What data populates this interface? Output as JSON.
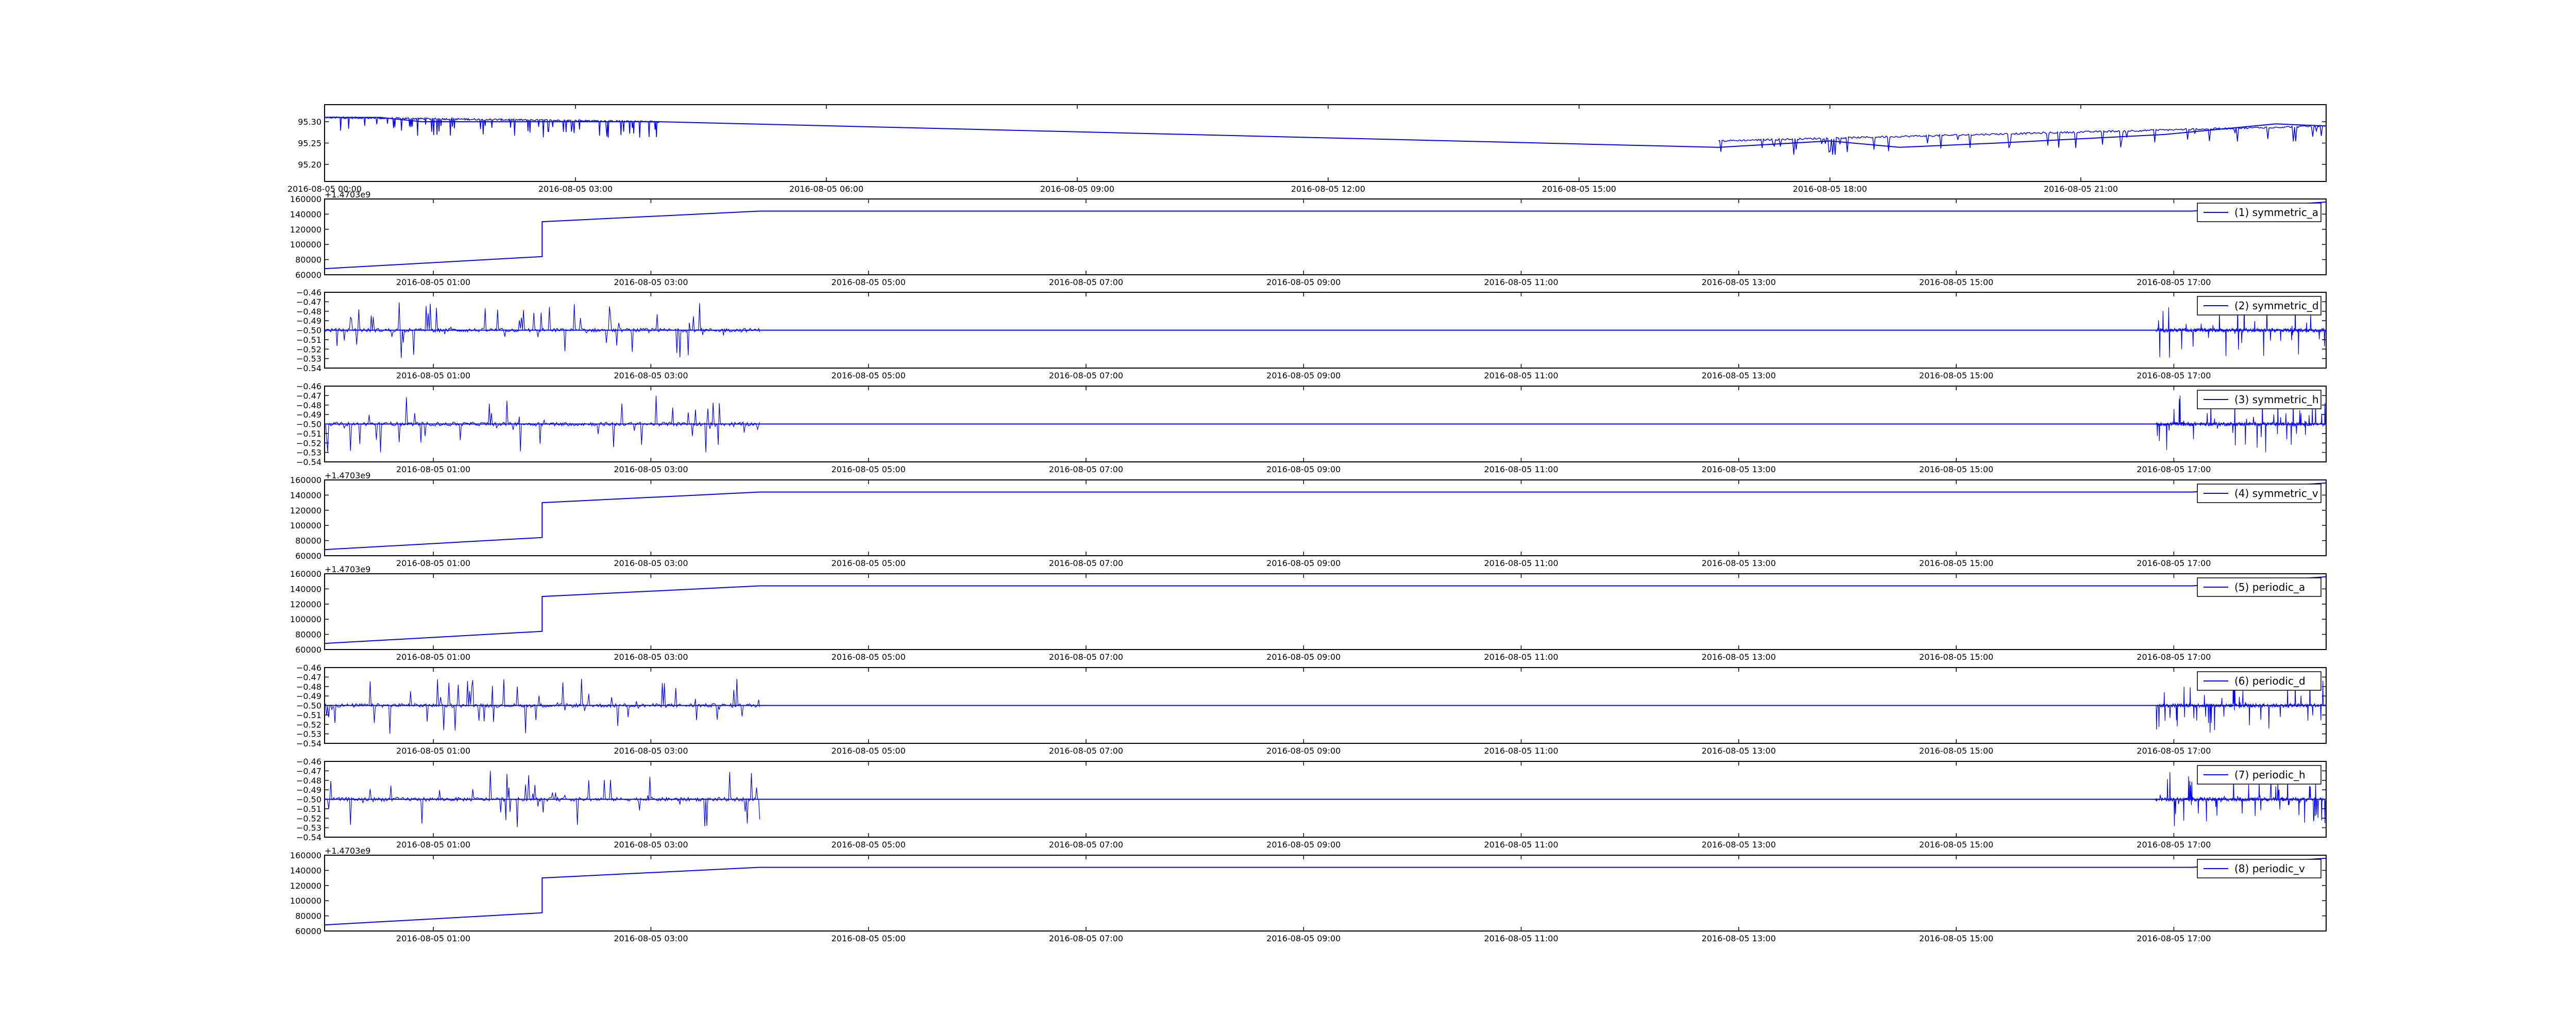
{
  "chart_data": [
    {
      "type": "line",
      "x_format": "datetime",
      "color": "#0000ff",
      "ylim": [
        95.16,
        95.34
      ],
      "y_ticks": [
        95.2,
        95.25,
        95.3
      ],
      "y_tick_labels": [
        "95.20",
        "95.25",
        "95.30"
      ],
      "x_ticks": [
        "2016-08-05 00:00",
        "2016-08-05 03:00",
        "2016-08-05 06:00",
        "2016-08-05 09:00",
        "2016-08-05 12:00",
        "2016-08-05 15:00",
        "2016-08-05 18:00",
        "2016-08-05 21:00"
      ],
      "x_tick_labels": [
        "2016-08-05 00:00",
        "2016-08-05 03:00",
        "2016-08-05 06:00",
        "2016-08-05 09:00",
        "2016-08-05 12:00",
        "2016-08-05 15:00",
        "2016-08-05 18:00",
        "2016-08-05 21:00"
      ],
      "xlim": [
        "2016-08-05 00:00",
        "2016-08-05 23:56"
      ],
      "series": [
        {
          "x": [
            "2016-08-05 00:00",
            "2016-08-05 00:40",
            "2016-08-05 01:10",
            "2016-08-05 02:00",
            "2016-08-05 03:00",
            "2016-08-05 04:00",
            "2016-08-05 16:40",
            "2016-08-05 18:00",
            "2016-08-05 18:50",
            "2016-08-05 20:00",
            "2016-08-05 22:00",
            "2016-08-05 23:20",
            "2016-08-05 23:56"
          ],
          "values": [
            95.31,
            95.31,
            95.3,
            95.3,
            95.3,
            95.3,
            95.24,
            95.255,
            95.24,
            95.25,
            95.27,
            95.295,
            95.29
          ]
        }
      ]
    },
    {
      "type": "line",
      "x_format": "datetime",
      "color": "#0000ff",
      "y_offset_label": "+1.4703e9",
      "ylim": [
        60000,
        160000
      ],
      "y_ticks": [
        60000,
        80000,
        100000,
        120000,
        140000,
        160000
      ],
      "y_tick_labels": [
        "60000",
        "80000",
        "100000",
        "120000",
        "140000",
        "160000"
      ],
      "x_ticks": [
        "2016-08-05 01:00",
        "2016-08-05 03:00",
        "2016-08-05 05:00",
        "2016-08-05 07:00",
        "2016-08-05 09:00",
        "2016-08-05 11:00",
        "2016-08-05 13:00",
        "2016-08-05 15:00",
        "2016-08-05 17:00"
      ],
      "x_tick_labels": [
        "2016-08-05 01:00",
        "2016-08-05 03:00",
        "2016-08-05 05:00",
        "2016-08-05 07:00",
        "2016-08-05 09:00",
        "2016-08-05 11:00",
        "2016-08-05 13:00",
        "2016-08-05 15:00",
        "2016-08-05 17:00"
      ],
      "xlim": [
        "2016-08-05 00:00",
        "2016-08-05 18:24"
      ],
      "legend_location": "upper right",
      "series": [
        {
          "name": "(1) symmetric_a",
          "x": [
            "2016-08-05 00:00",
            "2016-08-05 02:00",
            "2016-08-05 02:00",
            "2016-08-05 04:00",
            "2016-08-05 16:50",
            "2016-08-05 17:10",
            "2016-08-05 18:24"
          ],
          "values": [
            68000,
            84000,
            130000,
            144000,
            144000,
            144000,
            156000
          ]
        }
      ]
    },
    {
      "type": "line",
      "x_format": "datetime",
      "color": "#0000ff",
      "ylim": [
        -0.54,
        -0.46
      ],
      "y_ticks": [
        -0.54,
        -0.53,
        -0.52,
        -0.51,
        -0.5,
        -0.49,
        -0.48,
        -0.47,
        -0.46
      ],
      "y_tick_labels": [
        "−0.54",
        "−0.53",
        "−0.52",
        "−0.51",
        "−0.50",
        "−0.49",
        "−0.48",
        "−0.47",
        "−0.46"
      ],
      "x_ticks": [
        "2016-08-05 01:00",
        "2016-08-05 03:00",
        "2016-08-05 05:00",
        "2016-08-05 07:00",
        "2016-08-05 09:00",
        "2016-08-05 11:00",
        "2016-08-05 13:00",
        "2016-08-05 15:00",
        "2016-08-05 17:00"
      ],
      "x_tick_labels": [
        "2016-08-05 01:00",
        "2016-08-05 03:00",
        "2016-08-05 05:00",
        "2016-08-05 07:00",
        "2016-08-05 09:00",
        "2016-08-05 11:00",
        "2016-08-05 13:00",
        "2016-08-05 15:00",
        "2016-08-05 17:00"
      ],
      "xlim": [
        "2016-08-05 00:00",
        "2016-08-05 18:24"
      ],
      "legend_location": "upper right",
      "series": [
        {
          "name": "(2) symmetric_d",
          "x": [
            "2016-08-05 00:00",
            "2016-08-05 04:00",
            "2016-08-05 16:50",
            "2016-08-05 18:24"
          ],
          "values": [
            -0.5,
            -0.5,
            -0.5,
            -0.5
          ],
          "noise_range": [
            -0.53,
            -0.47
          ]
        }
      ]
    },
    {
      "type": "line",
      "x_format": "datetime",
      "color": "#0000ff",
      "ylim": [
        -0.54,
        -0.46
      ],
      "y_ticks": [
        -0.54,
        -0.53,
        -0.52,
        -0.51,
        -0.5,
        -0.49,
        -0.48,
        -0.47,
        -0.46
      ],
      "y_tick_labels": [
        "−0.54",
        "−0.53",
        "−0.52",
        "−0.51",
        "−0.50",
        "−0.49",
        "−0.48",
        "−0.47",
        "−0.46"
      ],
      "x_ticks": [
        "2016-08-05 01:00",
        "2016-08-05 03:00",
        "2016-08-05 05:00",
        "2016-08-05 07:00",
        "2016-08-05 09:00",
        "2016-08-05 11:00",
        "2016-08-05 13:00",
        "2016-08-05 15:00",
        "2016-08-05 17:00"
      ],
      "x_tick_labels": [
        "2016-08-05 01:00",
        "2016-08-05 03:00",
        "2016-08-05 05:00",
        "2016-08-05 07:00",
        "2016-08-05 09:00",
        "2016-08-05 11:00",
        "2016-08-05 13:00",
        "2016-08-05 15:00",
        "2016-08-05 17:00"
      ],
      "xlim": [
        "2016-08-05 00:00",
        "2016-08-05 18:24"
      ],
      "legend_location": "upper right",
      "series": [
        {
          "name": "(3) symmetric_h",
          "x": [
            "2016-08-05 00:00",
            "2016-08-05 04:00",
            "2016-08-05 16:50",
            "2016-08-05 18:24"
          ],
          "values": [
            -0.5,
            -0.5,
            -0.5,
            -0.5
          ],
          "noise_range": [
            -0.53,
            -0.47
          ]
        }
      ]
    },
    {
      "type": "line",
      "x_format": "datetime",
      "color": "#0000ff",
      "y_offset_label": "+1.4703e9",
      "ylim": [
        60000,
        160000
      ],
      "y_ticks": [
        60000,
        80000,
        100000,
        120000,
        140000,
        160000
      ],
      "y_tick_labels": [
        "60000",
        "80000",
        "100000",
        "120000",
        "140000",
        "160000"
      ],
      "x_ticks": [
        "2016-08-05 01:00",
        "2016-08-05 03:00",
        "2016-08-05 05:00",
        "2016-08-05 07:00",
        "2016-08-05 09:00",
        "2016-08-05 11:00",
        "2016-08-05 13:00",
        "2016-08-05 15:00",
        "2016-08-05 17:00"
      ],
      "x_tick_labels": [
        "2016-08-05 01:00",
        "2016-08-05 03:00",
        "2016-08-05 05:00",
        "2016-08-05 07:00",
        "2016-08-05 09:00",
        "2016-08-05 11:00",
        "2016-08-05 13:00",
        "2016-08-05 15:00",
        "2016-08-05 17:00"
      ],
      "xlim": [
        "2016-08-05 00:00",
        "2016-08-05 18:24"
      ],
      "legend_location": "upper right",
      "series": [
        {
          "name": "(4) symmetric_v",
          "x": [
            "2016-08-05 00:00",
            "2016-08-05 02:00",
            "2016-08-05 02:00",
            "2016-08-05 04:00",
            "2016-08-05 16:50",
            "2016-08-05 17:10",
            "2016-08-05 18:24"
          ],
          "values": [
            68000,
            84000,
            130000,
            144000,
            144000,
            144000,
            156000
          ]
        }
      ]
    },
    {
      "type": "line",
      "x_format": "datetime",
      "color": "#0000ff",
      "y_offset_label": "+1.4703e9",
      "ylim": [
        60000,
        160000
      ],
      "y_ticks": [
        60000,
        80000,
        100000,
        120000,
        140000,
        160000
      ],
      "y_tick_labels": [
        "60000",
        "80000",
        "100000",
        "120000",
        "140000",
        "160000"
      ],
      "x_ticks": [
        "2016-08-05 01:00",
        "2016-08-05 03:00",
        "2016-08-05 05:00",
        "2016-08-05 07:00",
        "2016-08-05 09:00",
        "2016-08-05 11:00",
        "2016-08-05 13:00",
        "2016-08-05 15:00",
        "2016-08-05 17:00"
      ],
      "x_tick_labels": [
        "2016-08-05 01:00",
        "2016-08-05 03:00",
        "2016-08-05 05:00",
        "2016-08-05 07:00",
        "2016-08-05 09:00",
        "2016-08-05 11:00",
        "2016-08-05 13:00",
        "2016-08-05 15:00",
        "2016-08-05 17:00"
      ],
      "xlim": [
        "2016-08-05 00:00",
        "2016-08-05 18:24"
      ],
      "legend_location": "upper right",
      "series": [
        {
          "name": "(5) periodic_a",
          "x": [
            "2016-08-05 00:00",
            "2016-08-05 02:00",
            "2016-08-05 02:00",
            "2016-08-05 04:00",
            "2016-08-05 16:50",
            "2016-08-05 17:10",
            "2016-08-05 18:24"
          ],
          "values": [
            68000,
            84000,
            130000,
            144000,
            144000,
            144000,
            156000
          ]
        }
      ]
    },
    {
      "type": "line",
      "x_format": "datetime",
      "color": "#0000ff",
      "ylim": [
        -0.54,
        -0.46
      ],
      "y_ticks": [
        -0.54,
        -0.53,
        -0.52,
        -0.51,
        -0.5,
        -0.49,
        -0.48,
        -0.47,
        -0.46
      ],
      "y_tick_labels": [
        "−0.54",
        "−0.53",
        "−0.52",
        "−0.51",
        "−0.50",
        "−0.49",
        "−0.48",
        "−0.47",
        "−0.46"
      ],
      "x_ticks": [
        "2016-08-05 01:00",
        "2016-08-05 03:00",
        "2016-08-05 05:00",
        "2016-08-05 07:00",
        "2016-08-05 09:00",
        "2016-08-05 11:00",
        "2016-08-05 13:00",
        "2016-08-05 15:00",
        "2016-08-05 17:00"
      ],
      "x_tick_labels": [
        "2016-08-05 01:00",
        "2016-08-05 03:00",
        "2016-08-05 05:00",
        "2016-08-05 07:00",
        "2016-08-05 09:00",
        "2016-08-05 11:00",
        "2016-08-05 13:00",
        "2016-08-05 15:00",
        "2016-08-05 17:00"
      ],
      "xlim": [
        "2016-08-05 00:00",
        "2016-08-05 18:24"
      ],
      "legend_location": "upper right",
      "series": [
        {
          "name": "(6) periodic_d",
          "x": [
            "2016-08-05 00:00",
            "2016-08-05 04:00",
            "2016-08-05 16:50",
            "2016-08-05 18:24"
          ],
          "values": [
            -0.5,
            -0.5,
            -0.5,
            -0.5
          ],
          "noise_range": [
            -0.53,
            -0.47
          ]
        }
      ]
    },
    {
      "type": "line",
      "x_format": "datetime",
      "color": "#0000ff",
      "ylim": [
        -0.54,
        -0.46
      ],
      "y_ticks": [
        -0.54,
        -0.53,
        -0.52,
        -0.51,
        -0.5,
        -0.49,
        -0.48,
        -0.47,
        -0.46
      ],
      "y_tick_labels": [
        "−0.54",
        "−0.53",
        "−0.52",
        "−0.51",
        "−0.50",
        "−0.49",
        "−0.48",
        "−0.47",
        "−0.46"
      ],
      "x_ticks": [
        "2016-08-05 01:00",
        "2016-08-05 03:00",
        "2016-08-05 05:00",
        "2016-08-05 07:00",
        "2016-08-05 09:00",
        "2016-08-05 11:00",
        "2016-08-05 13:00",
        "2016-08-05 15:00",
        "2016-08-05 17:00"
      ],
      "x_tick_labels": [
        "2016-08-05 01:00",
        "2016-08-05 03:00",
        "2016-08-05 05:00",
        "2016-08-05 07:00",
        "2016-08-05 09:00",
        "2016-08-05 11:00",
        "2016-08-05 13:00",
        "2016-08-05 15:00",
        "2016-08-05 17:00"
      ],
      "xlim": [
        "2016-08-05 00:00",
        "2016-08-05 18:24"
      ],
      "legend_location": "upper right",
      "series": [
        {
          "name": "(7) periodic_h",
          "x": [
            "2016-08-05 00:00",
            "2016-08-05 04:00",
            "2016-08-05 16:50",
            "2016-08-05 18:24"
          ],
          "values": [
            -0.5,
            -0.5,
            -0.5,
            -0.5
          ],
          "noise_range": [
            -0.53,
            -0.47
          ]
        }
      ]
    },
    {
      "type": "line",
      "x_format": "datetime",
      "color": "#0000ff",
      "y_offset_label": "+1.4703e9",
      "ylim": [
        60000,
        160000
      ],
      "y_ticks": [
        60000,
        80000,
        100000,
        120000,
        140000,
        160000
      ],
      "y_tick_labels": [
        "60000",
        "80000",
        "100000",
        "120000",
        "140000",
        "160000"
      ],
      "x_ticks": [
        "2016-08-05 01:00",
        "2016-08-05 03:00",
        "2016-08-05 05:00",
        "2016-08-05 07:00",
        "2016-08-05 09:00",
        "2016-08-05 11:00",
        "2016-08-05 13:00",
        "2016-08-05 15:00",
        "2016-08-05 17:00"
      ],
      "x_tick_labels": [
        "2016-08-05 01:00",
        "2016-08-05 03:00",
        "2016-08-05 05:00",
        "2016-08-05 07:00",
        "2016-08-05 09:00",
        "2016-08-05 11:00",
        "2016-08-05 13:00",
        "2016-08-05 15:00",
        "2016-08-05 17:00"
      ],
      "xlim": [
        "2016-08-05 00:00",
        "2016-08-05 18:24"
      ],
      "legend_location": "upper right",
      "series": [
        {
          "name": "(8) periodic_v",
          "x": [
            "2016-08-05 00:00",
            "2016-08-05 02:00",
            "2016-08-05 02:00",
            "2016-08-05 04:00",
            "2016-08-05 16:50",
            "2016-08-05 17:10",
            "2016-08-05 18:24"
          ],
          "values": [
            68000,
            84000,
            130000,
            144000,
            144000,
            144000,
            156000
          ]
        }
      ]
    }
  ]
}
